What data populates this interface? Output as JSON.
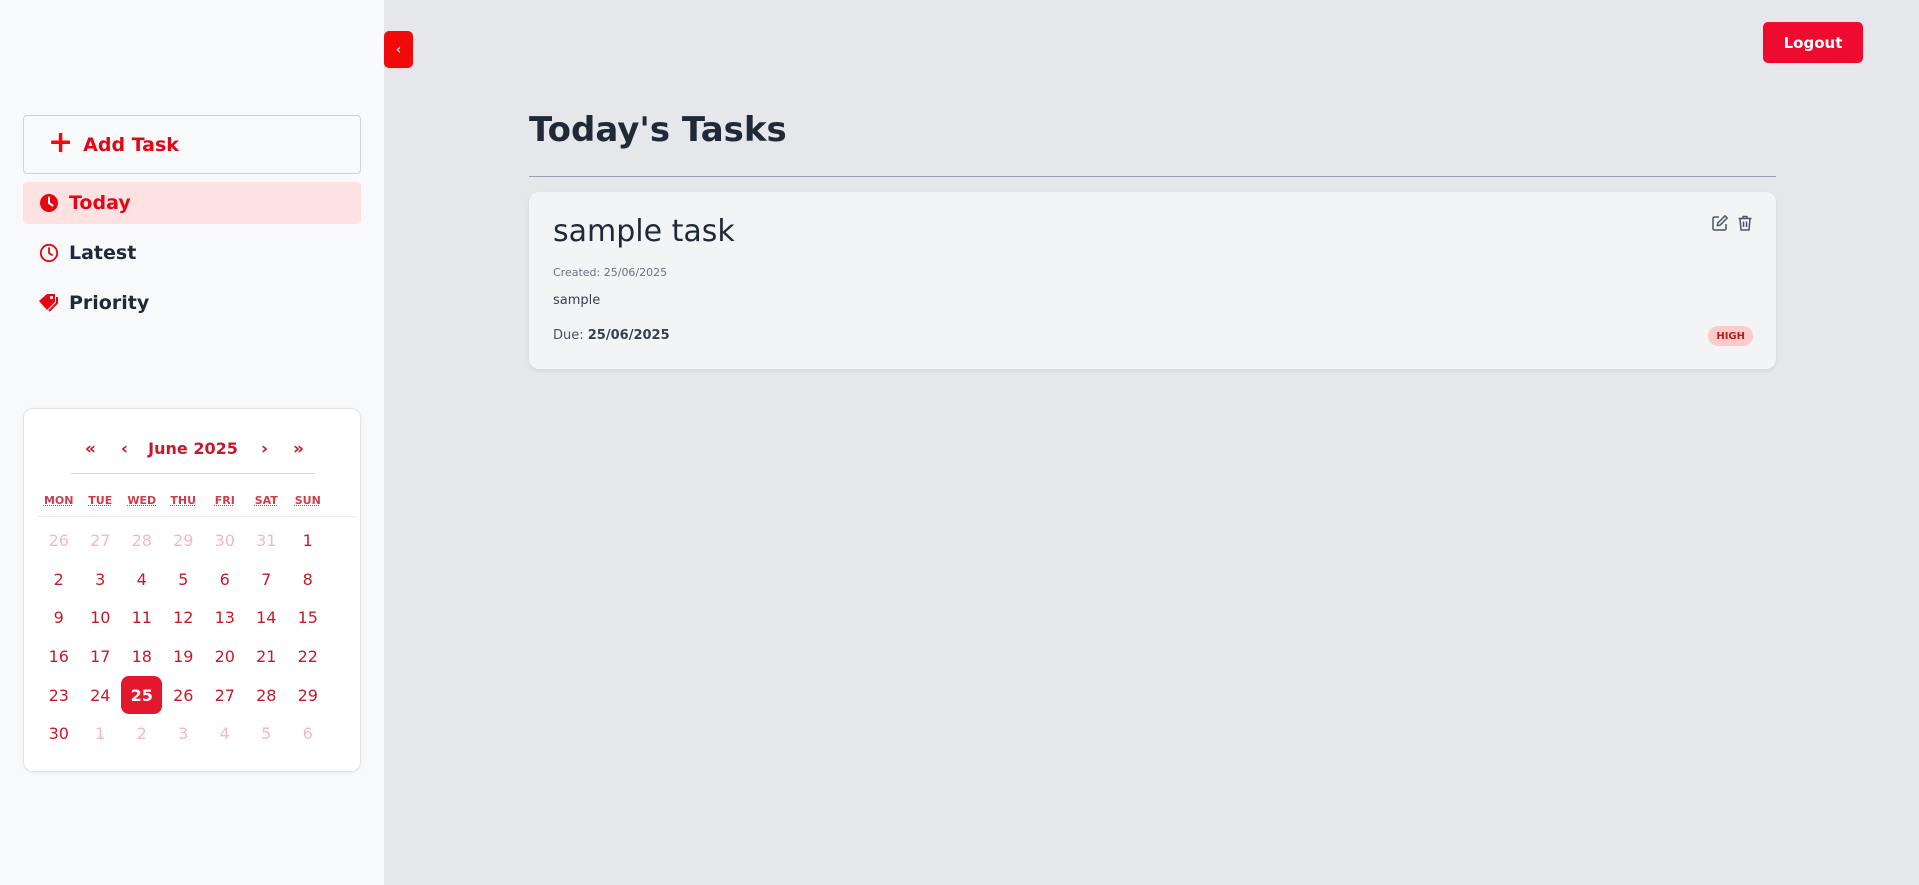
{
  "sidebar": {
    "add_task_label": "Add Task",
    "nav": [
      {
        "label": "Today",
        "icon": "clock-filled-icon",
        "active": true
      },
      {
        "label": "Latest",
        "icon": "clock-outline-icon",
        "active": false
      },
      {
        "label": "Priority",
        "icon": "tags-icon",
        "active": false
      }
    ]
  },
  "calendar": {
    "title": "June 2025",
    "prev_year": "«",
    "prev_month": "‹",
    "next_month": "›",
    "next_year": "»",
    "weekdays": [
      "MON",
      "TUE",
      "WED",
      "THU",
      "FRI",
      "SAT",
      "SUN"
    ],
    "days": [
      {
        "d": "26",
        "dim": true
      },
      {
        "d": "27",
        "dim": true
      },
      {
        "d": "28",
        "dim": true
      },
      {
        "d": "29",
        "dim": true
      },
      {
        "d": "30",
        "dim": true
      },
      {
        "d": "31",
        "dim": true
      },
      {
        "d": "1"
      },
      {
        "d": "2"
      },
      {
        "d": "3"
      },
      {
        "d": "4"
      },
      {
        "d": "5"
      },
      {
        "d": "6"
      },
      {
        "d": "7"
      },
      {
        "d": "8"
      },
      {
        "d": "9"
      },
      {
        "d": "10"
      },
      {
        "d": "11"
      },
      {
        "d": "12"
      },
      {
        "d": "13"
      },
      {
        "d": "14"
      },
      {
        "d": "15"
      },
      {
        "d": "16"
      },
      {
        "d": "17"
      },
      {
        "d": "18"
      },
      {
        "d": "19"
      },
      {
        "d": "20"
      },
      {
        "d": "21"
      },
      {
        "d": "22"
      },
      {
        "d": "23"
      },
      {
        "d": "24"
      },
      {
        "d": "25",
        "selected": true
      },
      {
        "d": "26"
      },
      {
        "d": "27"
      },
      {
        "d": "28"
      },
      {
        "d": "29"
      },
      {
        "d": "30"
      },
      {
        "d": "1",
        "dim": true
      },
      {
        "d": "2",
        "dim": true
      },
      {
        "d": "3",
        "dim": true
      },
      {
        "d": "4",
        "dim": true
      },
      {
        "d": "5",
        "dim": true
      },
      {
        "d": "6",
        "dim": true
      }
    ]
  },
  "header": {
    "toggle_icon": "‹",
    "logout_label": "Logout"
  },
  "main": {
    "title": "Today's Tasks",
    "tasks": [
      {
        "title": "sample task",
        "created": "Created: 25/06/2025",
        "description": "sample",
        "due_label": "Due: ",
        "due_date": "25/06/2025",
        "priority": "HIGH"
      }
    ]
  },
  "colors": {
    "accent": "#e30613",
    "active_bg": "#fee2e2",
    "badge_bg": "#fecaca"
  }
}
